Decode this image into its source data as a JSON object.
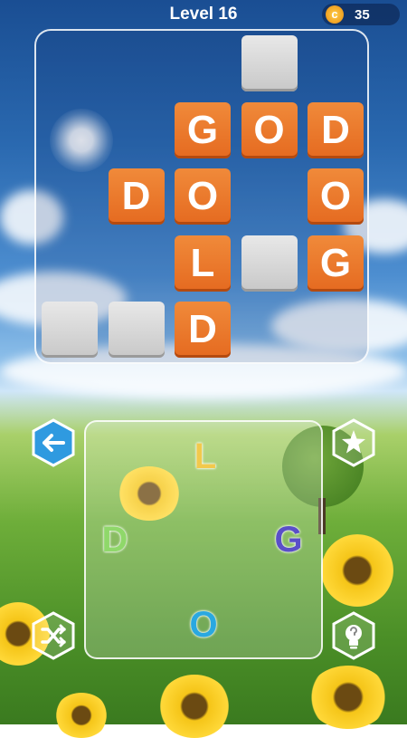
{
  "header": {
    "title": "Level 16",
    "coins": "35",
    "coin_symbol": "c"
  },
  "grid": {
    "tiles": [
      {
        "id": "r0c3",
        "row": 0,
        "col": 3,
        "letter": ""
      },
      {
        "id": "r1c2",
        "row": 1,
        "col": 2,
        "letter": "G"
      },
      {
        "id": "r1c3",
        "row": 1,
        "col": 3,
        "letter": "O"
      },
      {
        "id": "r1c4",
        "row": 1,
        "col": 4,
        "letter": "D"
      },
      {
        "id": "r2c1",
        "row": 2,
        "col": 1,
        "letter": "D"
      },
      {
        "id": "r2c2",
        "row": 2,
        "col": 2,
        "letter": "O"
      },
      {
        "id": "r2c4",
        "row": 2,
        "col": 4,
        "letter": "O"
      },
      {
        "id": "r3c2",
        "row": 3,
        "col": 2,
        "letter": "L"
      },
      {
        "id": "r3c3",
        "row": 3,
        "col": 3,
        "letter": ""
      },
      {
        "id": "r3c4",
        "row": 3,
        "col": 4,
        "letter": "G"
      },
      {
        "id": "r4c0",
        "row": 4,
        "col": 0,
        "letter": ""
      },
      {
        "id": "r4c1",
        "row": 4,
        "col": 1,
        "letter": ""
      },
      {
        "id": "r4c2",
        "row": 4,
        "col": 2,
        "letter": "D"
      }
    ]
  },
  "wheel": {
    "letters": [
      {
        "id": "top",
        "letter": "L",
        "color": "#f2c94c"
      },
      {
        "id": "left",
        "letter": "D",
        "color": "#8fd86a"
      },
      {
        "id": "right",
        "letter": "G",
        "color": "#5a4fc8"
      },
      {
        "id": "bottom",
        "letter": "O",
        "color": "#2aa8e0"
      }
    ]
  },
  "buttons": {
    "back": {
      "icon": "arrow-left-icon"
    },
    "favorite": {
      "icon": "star-icon"
    },
    "shuffle": {
      "icon": "shuffle-icon"
    },
    "hint": {
      "icon": "hint-bulb-icon"
    }
  }
}
